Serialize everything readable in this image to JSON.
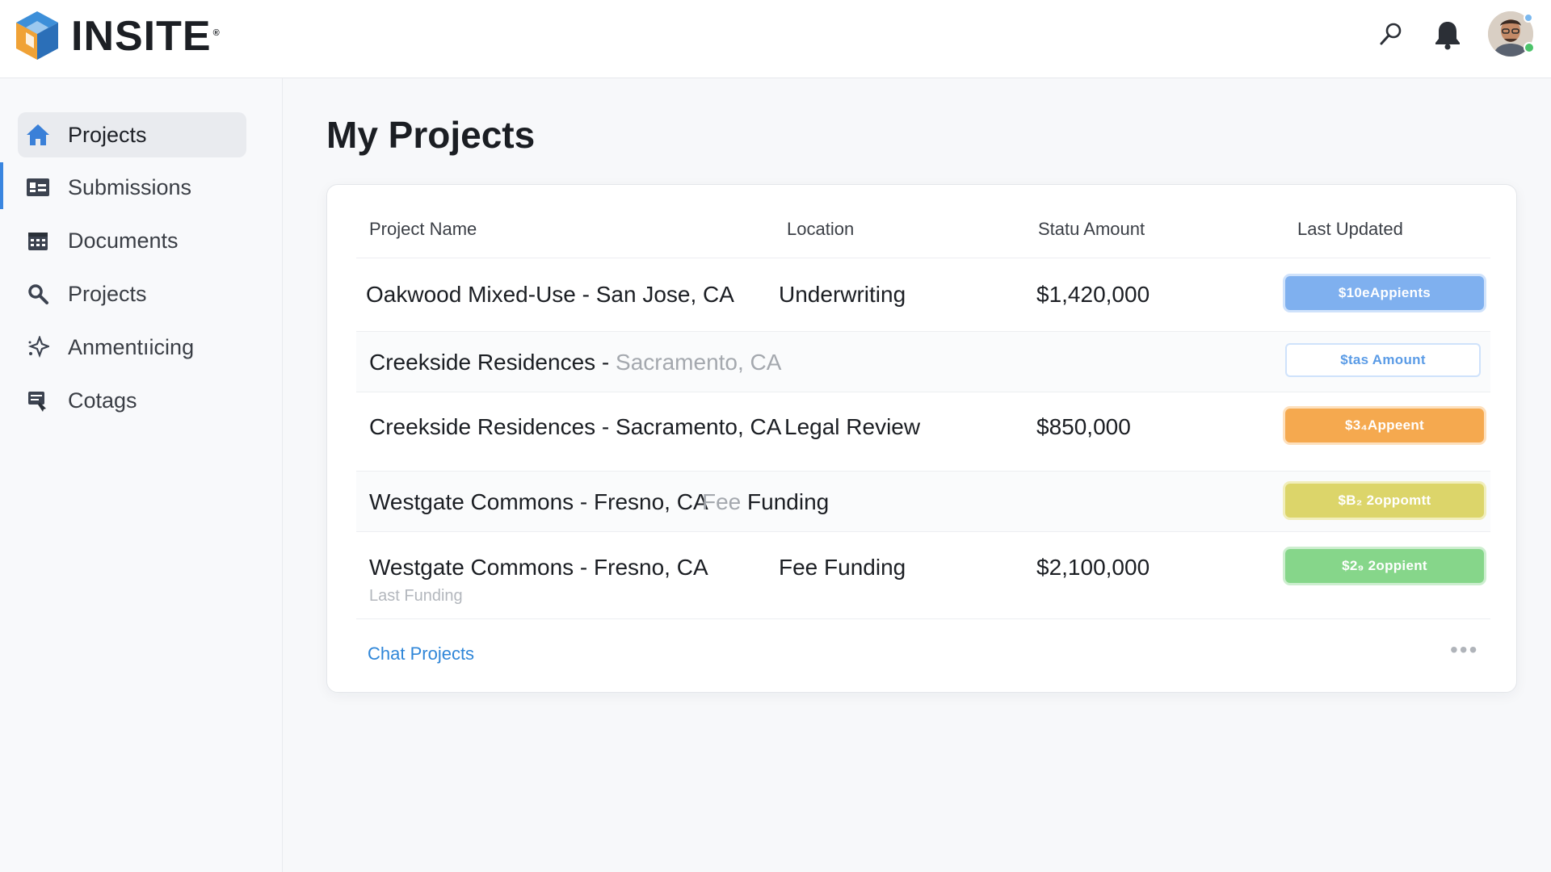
{
  "app": {
    "name": "INSITE",
    "reg_mark": "®"
  },
  "header": {
    "icons": [
      "search-icon",
      "bell-icon",
      "avatar"
    ]
  },
  "sidebar": {
    "items": [
      {
        "label": "Projects",
        "icon": "home-icon",
        "active": true
      },
      {
        "label": "Submissions",
        "icon": "id-card-icon",
        "active": false
      },
      {
        "label": "Documents",
        "icon": "calendar-icon",
        "active": false
      },
      {
        "label": "Projects",
        "icon": "search-icon",
        "active": false
      },
      {
        "label": "Anmentıicing",
        "icon": "sparkle-icon",
        "active": false
      },
      {
        "label": "Cotags",
        "icon": "tag-icon",
        "active": false
      }
    ]
  },
  "main": {
    "title": "My Projects",
    "table": {
      "columns": [
        "Project Name",
        "Location",
        "Statu Amount",
        "Last Updated"
      ],
      "rows": [
        {
          "name": "Oakwood Mixed-Use - San Jose, CA",
          "location": "Underwriting",
          "amount": "$1,420,000",
          "badge": "$10eAppients",
          "badge_color": "#7fb0ef"
        },
        {
          "name": "Creekside Residences - ",
          "name_muted": "Sacramento, CA",
          "location": "",
          "amount": "",
          "badge": "$tas Amount",
          "badge_color": "#ffffff"
        },
        {
          "name": "Creekside Residences - Sacramento, CA",
          "location": "Legal Review",
          "amount": "$850,000",
          "badge": "$3₄Appeent",
          "badge_color": "#f5a94f"
        },
        {
          "name": "Westgate Commons - Fresno, CA",
          "location_muted": "Fee",
          "location": " Funding",
          "amount": "",
          "badge": "$B₂ 2oppomtt",
          "badge_color": "#dcd56a"
        },
        {
          "name": "Westgate Commons - Fresno, CA",
          "sub": "Last Funding",
          "location": "Fee Funding",
          "amount": "$2,100,000",
          "badge": "$2₉ 2oppient",
          "badge_color": "#86d68a"
        }
      ]
    },
    "footer": {
      "link": "Chat Projects",
      "more": "•••"
    }
  }
}
